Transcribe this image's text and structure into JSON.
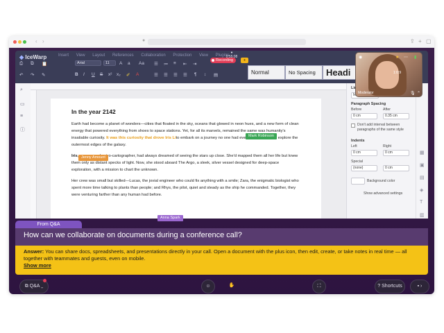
{
  "browser": {
    "url": ""
  },
  "app": {
    "logo": "IceWarp",
    "menu": [
      "Insert",
      "View",
      "Layout",
      "References",
      "Collaboration",
      "Protection",
      "View",
      "Plugins"
    ],
    "timer": "0:55:08",
    "recording_label": "Recording",
    "font_name": "Arial",
    "font_size": "11",
    "styles": [
      "Normal",
      "No Spacing",
      "Headi"
    ]
  },
  "video": {
    "name": "Moderator",
    "time": "1:0:9"
  },
  "doc": {
    "title": "In the year 2142",
    "p1_a": "Earth had become a planet of wonders—cities that floated in the sky, oceans that glowed in neon hues, and a new form of clean energy that powered everything from shoes to space stations. Yet, for all its marvels,",
    "p1_b": "remained the same was humanity's insatiable curiosity.",
    "p1_highlight": "It was this curiosity that drove Iris Li",
    "p1_c": "to embark on a journey no one had ever dared before: to explore the outermost edges of the galaxy.",
    "p2_name": "Iris",
    "p2": ", a renowned astro-cartographer, had always dreamed of seeing the stars up close. She'd mapped them all her life but knew them only as distant specks of light. Now, she stood aboard The Argo, a sleek, silver vessel designed for deep-space exploration, with a mission to chart the unknown.",
    "p3": "Her crew was small but skilled—Lucas, the jovial engineer who could fix anything with a smile; Zara, the enigmatic biologist who spent more time talking to plants than people; and Rhys, the pilot, quiet and steady as the ship he commanded. Together, they were venturing farther than any human had before.",
    "cursors": [
      {
        "name": "Mark Robinson",
        "color": "#3aa655"
      },
      {
        "name": "Jenny Amount",
        "color": "#e8963a"
      },
      {
        "name": "Anna Spark",
        "color": "#9b68d0"
      }
    ]
  },
  "panel": {
    "line_spacing_label": "Line S",
    "line_spacing_value": "Multiple",
    "paragraph_spacing": "Paragraph Spacing",
    "before": "Before",
    "after": "After",
    "before_value": "0 cm",
    "after_value": "0.35 cm",
    "dont_add": "Don't add interval between paragraphs of the same style",
    "indents": "Indents",
    "left": "Left",
    "right": "Right",
    "left_value": "0 cm",
    "right_value": "0 cm",
    "special": "Special",
    "special_value": "(none)",
    "special_amount": "0 cm",
    "bg_color": "Background color",
    "advanced": "Show advanced settings"
  },
  "qa": {
    "tab": "From Q&A",
    "question": "How can we collaborate on documents during a conference call?",
    "answer_label": "Answer:",
    "answer": "You can share docs, spreadsheets, and presentations directly in your call. Open a document with the plus icon, then edit, create, or take notes in real time — all together with teammates and guests, even on mobile.",
    "show_more": "Show more"
  },
  "bottom": {
    "qa_label": "Q&A",
    "shortcuts_label": "Shortcuts"
  },
  "colors": {
    "accent": "#7e54c0",
    "answer_bg": "#f4c216",
    "recording": "#e23d57"
  }
}
